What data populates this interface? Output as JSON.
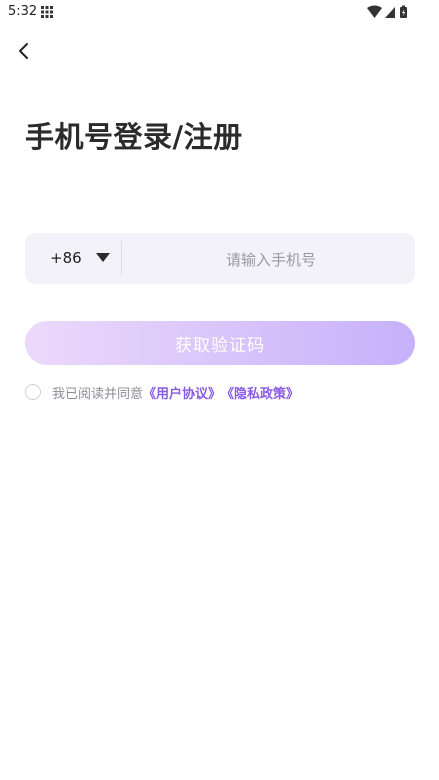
{
  "status_bar": {
    "time": "5:32"
  },
  "header": {
    "title": "手机号登录/注册"
  },
  "phone": {
    "country_code": "+86",
    "placeholder": "请输入手机号"
  },
  "actions": {
    "get_code_label": "获取验证码"
  },
  "agreement": {
    "prefix": "我已阅读并同意",
    "user_agreement": "《用户协议》",
    "privacy_policy": "《隐私政策》"
  },
  "colors": {
    "link": "#8a5be3",
    "button_gradient_start": "#ecd9fa",
    "button_gradient_end": "#c6b1fb",
    "input_bg": "#f3f2f8"
  }
}
